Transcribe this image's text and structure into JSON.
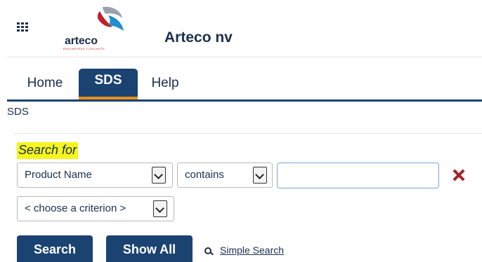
{
  "header": {
    "logo_text": "arteco",
    "logo_tagline": "ENGINEERED COOLANTS",
    "company_name": "Arteco nv"
  },
  "nav": {
    "tabs": [
      {
        "label": "Home",
        "active": false
      },
      {
        "label": "SDS",
        "active": true
      },
      {
        "label": "Help",
        "active": false
      }
    ]
  },
  "breadcrumb": "SDS",
  "search": {
    "heading": "Search for",
    "field_select": "Product Name",
    "operator_select": "contains",
    "value": "",
    "criterion_select": "< choose a criterion >"
  },
  "buttons": {
    "search": "Search",
    "show_all": "Show All",
    "simple_search": "Simple Search"
  },
  "icons": {
    "apps": "apps-grid-icon",
    "remove": "close-icon",
    "magnifier": "search-icon"
  },
  "colors": {
    "navy": "#1b4372",
    "text": "#1b2f4e",
    "orange": "#e8901d",
    "remove_red": "#a1232f",
    "highlight": "#f6f51c"
  }
}
